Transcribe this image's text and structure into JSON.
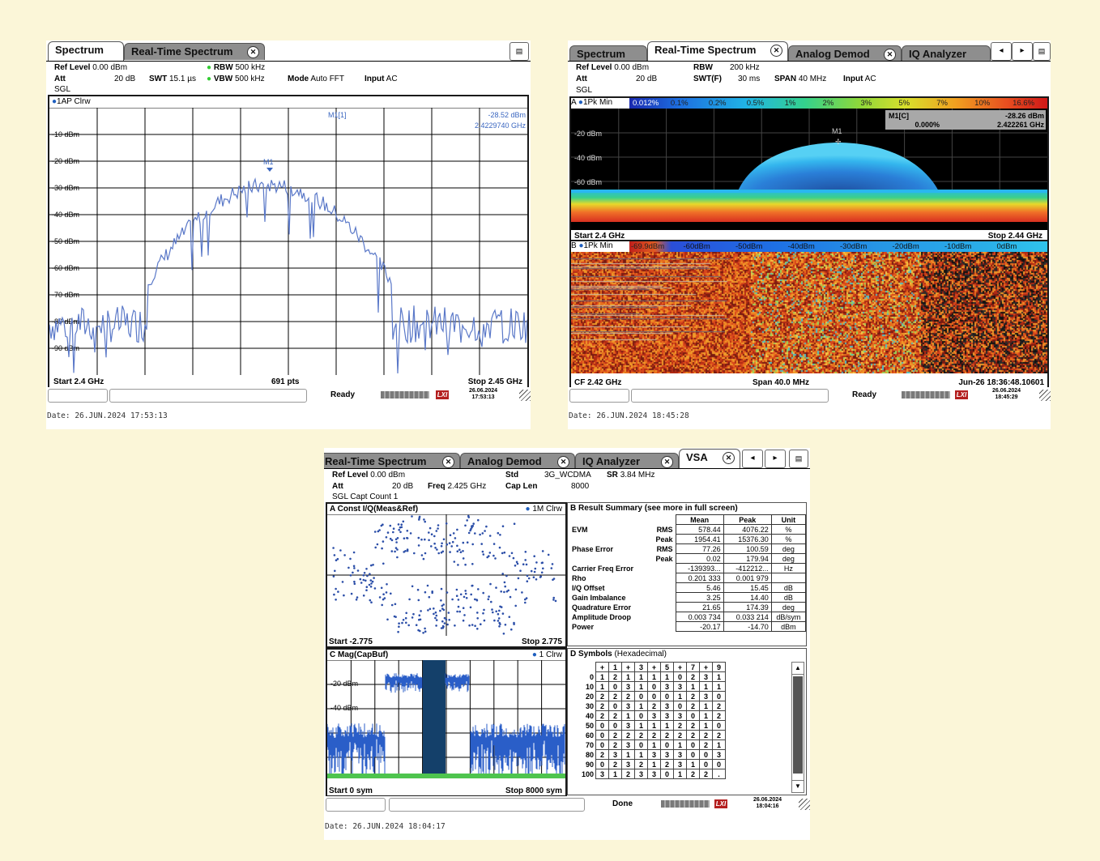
{
  "colors": {
    "background": "#fbf6d8",
    "trace": "#5a78c8",
    "const_dots": "#2b4ea8",
    "tab_inactive": "#8e8e8e"
  },
  "s1": {
    "tabs": [
      {
        "label": "Spectrum",
        "active": true
      },
      {
        "label": "Real-Time Spectrum",
        "active": false
      }
    ],
    "hdr": {
      "ref_level_k": "Ref Level",
      "ref_level_v": "0.00 dBm",
      "att_k": "Att",
      "att_v": "20 dB",
      "sgl": "SGL",
      "swt_k": "SWT",
      "swt_v": "15.1 µs",
      "rbw_k": "RBW",
      "rbw_v": "500 kHz",
      "vbw_k": "VBW",
      "vbw_v": "500 kHz",
      "mode_k": "Mode",
      "mode_v": "Auto FFT",
      "input_k": "Input",
      "input_v": "AC"
    },
    "trace_label": "1AP Clrw",
    "marker": {
      "name": "M1[1]",
      "level": "-28.52 dBm",
      "freq": "2.4229740 GHz",
      "tag": "M1"
    },
    "yticks": [
      "-10 dBm",
      "-20 dBm",
      "-30 dBm",
      "-40 dBm",
      "-50 dBm",
      "-60 dBm",
      "-70 dBm",
      "-80 dBm",
      "-90 dBm"
    ],
    "foot": {
      "start": "Start 2.4 GHz",
      "pts": "691 pts",
      "stop": "Stop 2.45 GHz"
    },
    "status": {
      "text": "Ready",
      "date": "26.06.2024",
      "time": "17:53:13",
      "logo": "LXI"
    },
    "caption": "Date: 26.JUN.2024  17:53:13"
  },
  "s2": {
    "tabs": [
      {
        "label": "Spectrum"
      },
      {
        "label": "Real-Time Spectrum"
      },
      {
        "label": "Analog Demod"
      },
      {
        "label": "IQ Analyzer"
      }
    ],
    "hdr": {
      "ref_level_k": "Ref Level",
      "ref_level_v": "0.00 dBm",
      "att_k": "Att",
      "att_v": "20 dB",
      "sgl": "SGL",
      "rbw_k": "RBW",
      "rbw_v": "200 kHz",
      "swt_k": "SWT(F)",
      "swt_v": "30 ms",
      "span_k": "SPAN",
      "span_v": "40 MHz",
      "input_k": "Input",
      "input_v": "AC"
    },
    "panelA": {
      "label": "A",
      "trace": "1Pk Min",
      "scale": [
        "0.012%",
        "0.1%",
        "0.2%",
        "0.5%",
        "1%",
        "2%",
        "3%",
        "5%",
        "7%",
        "10%",
        "16.6%"
      ],
      "yticks": [
        "-20 dBm",
        "-40 dBm",
        "-60 dBm"
      ],
      "marker_tag": "M1",
      "marker_name": "M1[C]",
      "marker_pct": "0.000%",
      "marker_level": "-28.26 dBm",
      "marker_freq": "2.422261 GHz",
      "start": "Start 2.4 GHz",
      "stop": "Stop 2.44 GHz"
    },
    "panelB": {
      "label": "B",
      "trace": "1Pk Min",
      "scale": [
        "-69.9dBm",
        "-60dBm",
        "-50dBm",
        "-40dBm",
        "-30dBm",
        "-20dBm",
        "-10dBm",
        "0dBm"
      ],
      "cf": "CF 2.42 GHz",
      "span": "Span 40.0 MHz",
      "ts": "Jun-26 18:36:48.10601"
    },
    "status": {
      "text": "Ready",
      "date": "26.06.2024",
      "time": "18:45:29",
      "logo": "LXI"
    },
    "caption": "Date: 26.JUN.2024  18:45:28"
  },
  "s3": {
    "tabs": [
      {
        "label": "Real-Time Spectrum"
      },
      {
        "label": "Analog Demod"
      },
      {
        "label": "IQ Analyzer"
      },
      {
        "label": "VSA"
      }
    ],
    "hdr": {
      "ref_level_k": "Ref Level",
      "ref_level_v": "0.00 dBm",
      "att_k": "Att",
      "att_v": "20 dB",
      "sgl": "SGL Capt Count 1",
      "freq_k": "Freq",
      "freq_v": "2.425 GHz",
      "std_k": "Std",
      "std_v": "3G_WCDMA",
      "sr_k": "SR",
      "sr_v": "3.84 MHz",
      "caplen_k": "Cap Len",
      "caplen_v": "8000"
    },
    "panelA": {
      "title": "A Const I/Q(Meas&Ref)",
      "trace": "1M Clrw",
      "start": "Start -2.775",
      "stop": "Stop 2.775"
    },
    "panelB": {
      "title": "B Result Summary (see more in full screen)",
      "headers": [
        "Mean",
        "Peak",
        "Unit"
      ],
      "rows": [
        {
          "name": "EVM",
          "sub": "RMS",
          "mean": "578.44",
          "peak": "4076.22",
          "unit": "%"
        },
        {
          "name": "",
          "sub": "Peak",
          "mean": "1954.41",
          "peak": "15376.30",
          "unit": "%"
        },
        {
          "name": "Phase Error",
          "sub": "RMS",
          "mean": "77.26",
          "peak": "100.59",
          "unit": "deg"
        },
        {
          "name": "",
          "sub": "Peak",
          "mean": "0.02",
          "peak": "179.94",
          "unit": "deg"
        },
        {
          "name": "Carrier Freq Error",
          "sub": "",
          "mean": "-139393...",
          "peak": "-412212...",
          "unit": "Hz"
        },
        {
          "name": "Rho",
          "sub": "",
          "mean": "0.201 333",
          "peak": "0.001 979",
          "unit": ""
        },
        {
          "name": "I/Q Offset",
          "sub": "",
          "mean": "5.46",
          "peak": "15.45",
          "unit": "dB"
        },
        {
          "name": "Gain Imbalance",
          "sub": "",
          "mean": "3.25",
          "peak": "14.40",
          "unit": "dB"
        },
        {
          "name": "Quadrature Error",
          "sub": "",
          "mean": "21.65",
          "peak": "174.39",
          "unit": "deg"
        },
        {
          "name": "Amplitude Droop",
          "sub": "",
          "mean": "0.003 734",
          "peak": "0.033 214",
          "unit": "dB/sym"
        },
        {
          "name": "Power",
          "sub": "",
          "mean": "-20.17",
          "peak": "-14.70",
          "unit": "dBm"
        }
      ]
    },
    "panelC": {
      "title": "C Mag(CapBuf)",
      "trace": "1 Clrw",
      "yticks": [
        "-20 dBm",
        "-40 dBm"
      ],
      "start": "Start 0 sym",
      "stop": "Stop 8000 sym"
    },
    "panelD": {
      "title": "D Symbols",
      "subtitle": "(Hexadecimal)",
      "cols": [
        "+",
        "1",
        "+",
        "3",
        "+",
        "5",
        "+",
        "7",
        "+",
        "9"
      ],
      "rows": [
        {
          "h": "0",
          "v": [
            "1",
            "2",
            "1",
            "1",
            "1",
            "1",
            "0",
            "2",
            "3",
            "1"
          ]
        },
        {
          "h": "10",
          "v": [
            "1",
            "0",
            "3",
            "1",
            "0",
            "3",
            "3",
            "1",
            "1",
            "1"
          ]
        },
        {
          "h": "20",
          "v": [
            "2",
            "2",
            "2",
            "0",
            "0",
            "0",
            "1",
            "2",
            "3",
            "0"
          ]
        },
        {
          "h": "30",
          "v": [
            "2",
            "0",
            "3",
            "1",
            "2",
            "3",
            "0",
            "2",
            "1",
            "2"
          ]
        },
        {
          "h": "40",
          "v": [
            "2",
            "2",
            "1",
            "0",
            "3",
            "3",
            "3",
            "0",
            "1",
            "2"
          ]
        },
        {
          "h": "50",
          "v": [
            "0",
            "0",
            "3",
            "1",
            "1",
            "1",
            "2",
            "2",
            "1",
            "0"
          ]
        },
        {
          "h": "60",
          "v": [
            "0",
            "2",
            "2",
            "2",
            "2",
            "2",
            "2",
            "2",
            "2",
            "2"
          ]
        },
        {
          "h": "70",
          "v": [
            "0",
            "2",
            "3",
            "0",
            "1",
            "0",
            "1",
            "0",
            "2",
            "1"
          ]
        },
        {
          "h": "80",
          "v": [
            "2",
            "3",
            "1",
            "1",
            "3",
            "3",
            "3",
            "0",
            "0",
            "3"
          ]
        },
        {
          "h": "90",
          "v": [
            "0",
            "2",
            "3",
            "2",
            "1",
            "2",
            "3",
            "1",
            "0",
            "0"
          ]
        },
        {
          "h": "100",
          "v": [
            "3",
            "1",
            "2",
            "3",
            "3",
            "0",
            "1",
            "2",
            "2",
            "."
          ]
        }
      ]
    },
    "status": {
      "text": "Done",
      "date": "26.06.2024",
      "time": "18:04:16",
      "logo": "LXI"
    },
    "caption": "Date: 26.JUN.2024  18:04:17"
  }
}
